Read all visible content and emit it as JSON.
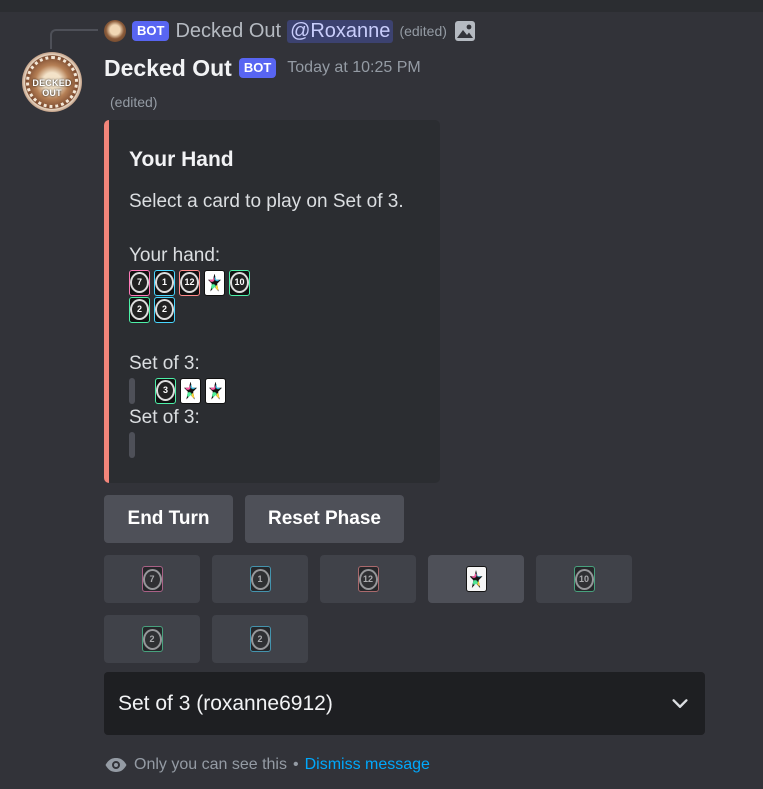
{
  "reply": {
    "bot_tag": "BOT",
    "name": "Decked Out",
    "mention": "@Roxanne",
    "edited": "(edited)",
    "attachment_icon": "image-icon"
  },
  "message": {
    "username": "Decked Out",
    "bot_tag": "BOT",
    "timestamp": "Today at 10:25 PM",
    "edited": "(edited)",
    "avatar_text": "DECKED OUT"
  },
  "embed": {
    "accent_color": "#f2857a",
    "title": "Your Hand",
    "description": "Select a card to play on Set of 3.",
    "hand_label": "Your hand:",
    "hand_row1": [
      {
        "value": "7",
        "color": "pink"
      },
      {
        "value": "1",
        "color": "cyan"
      },
      {
        "value": "12",
        "color": "red"
      },
      {
        "value": "wild",
        "color": "multi"
      },
      {
        "value": "10",
        "color": "green"
      }
    ],
    "hand_row2": [
      {
        "value": "2",
        "color": "green"
      },
      {
        "value": "2",
        "color": "cyan"
      }
    ],
    "set1_label": "Set of 3:",
    "set1_cards": [
      {
        "value": "3",
        "color": "green"
      },
      {
        "value": "wild",
        "color": "multi"
      },
      {
        "value": "wild",
        "color": "multi"
      }
    ],
    "set2_label": "Set of 3:"
  },
  "buttons": {
    "end_turn": "End Turn",
    "reset_phase": "Reset Phase"
  },
  "card_buttons": [
    {
      "value": "7",
      "color": "pink"
    },
    {
      "value": "1",
      "color": "cyan"
    },
    {
      "value": "12",
      "color": "red"
    },
    {
      "value": "wild",
      "color": "multi",
      "active": true
    },
    {
      "value": "10",
      "color": "green"
    },
    {
      "value": "2",
      "color": "green"
    },
    {
      "value": "2",
      "color": "cyan"
    }
  ],
  "select": {
    "value": "Set of 3 (roxanne6912)",
    "icon": "chevron-down-icon"
  },
  "footer": {
    "note": "Only you can see this",
    "separator": "•",
    "dismiss": "Dismiss message",
    "icon": "eye-icon"
  },
  "colors": {
    "background": "#323339",
    "embed_bg": "#2b2d31",
    "bot_tag": "#5865f2",
    "link": "#00a8fc",
    "button": "#4e5058"
  }
}
